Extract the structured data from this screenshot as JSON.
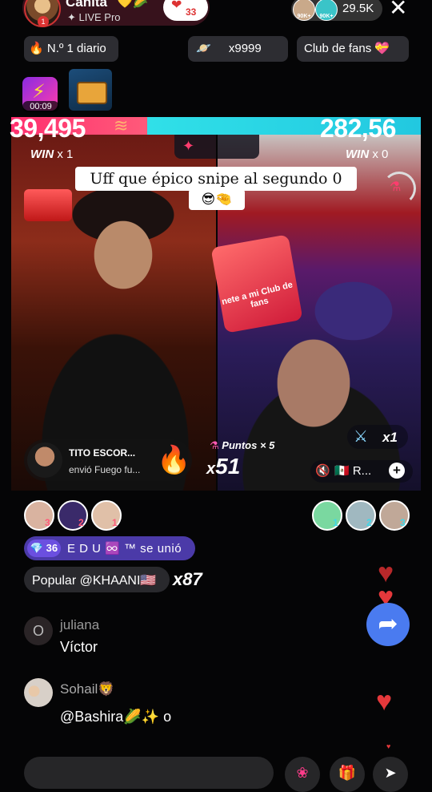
{
  "host": {
    "name": "Canita",
    "name_decoration": "💛🌽",
    "subtitle": "✦ LIVE Pro",
    "level": "1",
    "fan_badge_icon": "heart-lock-icon",
    "fan_badge_count": "33"
  },
  "viewers": {
    "top_viewer_1": "90K+",
    "top_viewer_2": "90K+",
    "count": "29.5K",
    "close_icon": "close-icon"
  },
  "chips": {
    "daily_rank": "N.º 1 diario",
    "daily_rank_icon": "flame-icon",
    "multiplier": "x9999",
    "multiplier_icon": "planet-icon",
    "fan_club": "Club de fans",
    "fan_club_icon": "hearts-gift-icon"
  },
  "boost": {
    "timer": "00:09",
    "icon": "lightning-boost-icon",
    "chest_icon": "treasure-chest-icon"
  },
  "battle": {
    "left_score": "39,495",
    "right_score": "282,56",
    "left_win_label": "WIN",
    "left_win_count": "x 1",
    "right_win_label": "WIN",
    "right_win_count": "x 0",
    "caption": "Uff que épico snipe al segundo 0",
    "caption_emoji": "😎🤏",
    "fan_club_sticker": "nete a mi Club de fans",
    "gifter_name": "TITO ESCOR...",
    "gifter_action": "envió Fuego fu...",
    "points_label": "Puntos × 5",
    "combo_prefix": "x",
    "combo_value": "51",
    "opponent_multiplier": "x1",
    "opponent_name": "🇲🇽 R...",
    "add_icon": "plus-icon",
    "colors": {
      "left": "#ff2f6e",
      "right": "#30e0e8"
    }
  },
  "rankings": {
    "left": [
      "3",
      "2",
      "1"
    ],
    "right": [
      "1",
      "2",
      "3"
    ]
  },
  "join": {
    "level": "💎 36",
    "text": "E D U ♾️ ™ se unió"
  },
  "popular": {
    "text": "Popular @KHAANI🇺🇸",
    "combo": "x87"
  },
  "comments": [
    {
      "avatar_initial": "O",
      "user": "juliana",
      "text": "Víctor"
    },
    {
      "avatar_initial": "",
      "user": "Sohail🦁",
      "text": "@Bashira🌽✨ o"
    }
  ],
  "side": {
    "heart_icon": "heart-icon",
    "share_icon": "share-arrow-icon"
  },
  "bottom": {
    "gift_icon": "gift-icon",
    "rose_icon": "rose-icon",
    "share_icon": "share-icon"
  }
}
